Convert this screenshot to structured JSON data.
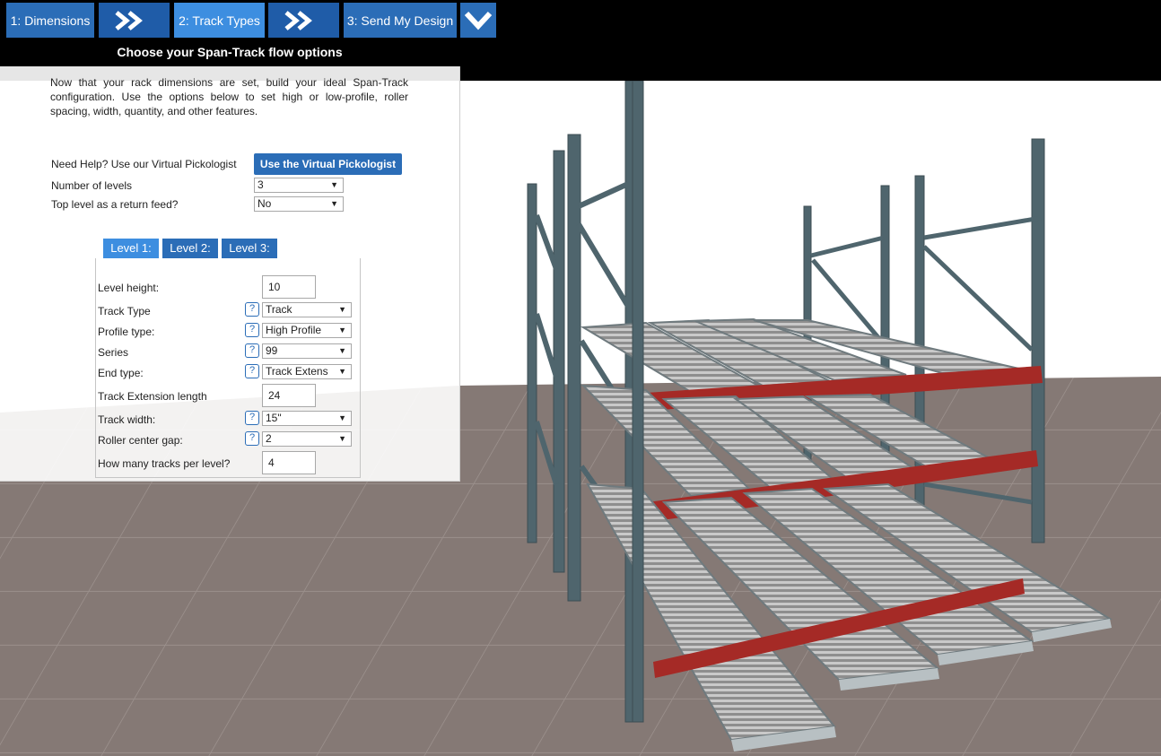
{
  "steps": {
    "dimensions": "1: Dimensions",
    "track_types": "2: Track Types",
    "send_design": "3: Send My Design"
  },
  "panel": {
    "title": "Choose your Span-Track flow options",
    "intro": "Now that your rack dimensions are set, build your ideal Span-Track configuration. Use the options below to set high or low-profile, roller spacing, width, quantity, and other features.",
    "help_label": "Need Help? Use our Virtual Pickologist",
    "help_button": "Use the Virtual Pickologist",
    "levels_label": "Number of levels",
    "levels_value": "3",
    "return_label": "Top level as a return feed?",
    "return_value": "No"
  },
  "tabs": [
    "Level 1:",
    "Level 2:",
    "Level 3:"
  ],
  "level": {
    "height_label": "Level height:",
    "height_value": "10",
    "track_type_label": "Track Type",
    "track_type_value": "Track",
    "profile_label": "Profile type:",
    "profile_value": "High Profile",
    "series_label": "Series",
    "series_value": "99",
    "end_label": "End type:",
    "end_value": "Track Extens",
    "ext_label": "Track Extension length",
    "ext_value": "24",
    "width_label": "Track width:",
    "width_value": "15\"",
    "gap_label": "Roller center gap:",
    "gap_value": "2",
    "count_label": "How many tracks per level?",
    "count_value": "4"
  },
  "help_mark": "?",
  "colors": {
    "accent": "#2b6db7",
    "accent_active": "#3d8ee0",
    "frame": "#4d646c",
    "beam": "#a52a26",
    "floor": "#8a7e7a"
  }
}
